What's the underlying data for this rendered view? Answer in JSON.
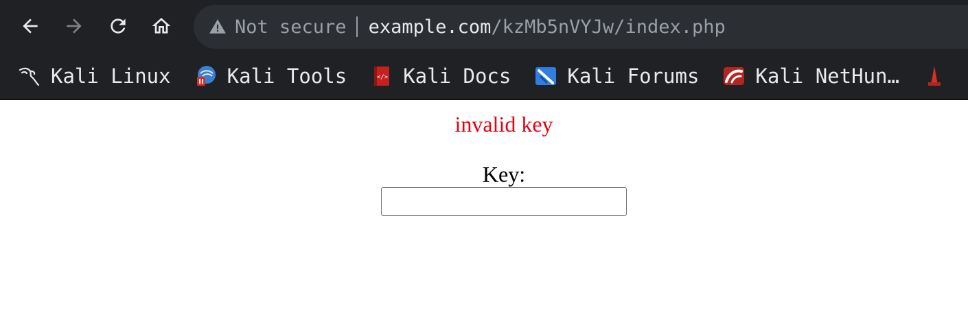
{
  "browser": {
    "nav": {
      "back_icon": "arrow-left-icon",
      "forward_icon": "arrow-right-icon",
      "reload_icon": "reload-icon",
      "home_icon": "home-icon"
    },
    "omnibox": {
      "security_icon": "warning-triangle-icon",
      "security_label": "Not secure",
      "url_domain": "example.com",
      "url_path": "/kzMb5nVYJw/index.php"
    },
    "bookmarks": [
      {
        "label": "Kali Linux",
        "icon": "kali-dragon-icon"
      },
      {
        "label": "Kali Tools",
        "icon": "kali-tools-icon"
      },
      {
        "label": "Kali Docs",
        "icon": "kali-docs-icon"
      },
      {
        "label": "Kali Forums",
        "icon": "kali-forums-icon"
      },
      {
        "label": "Kali NetHun…",
        "icon": "kali-nethunter-icon"
      },
      {
        "label": "",
        "icon": "exploit-db-icon"
      }
    ]
  },
  "page": {
    "error_message": "invalid key",
    "key_label": "Key:",
    "key_value": ""
  },
  "colors": {
    "chrome_bg": "#202124",
    "omnibox_bg": "#2b2e33",
    "error_text": "#e8000d"
  }
}
